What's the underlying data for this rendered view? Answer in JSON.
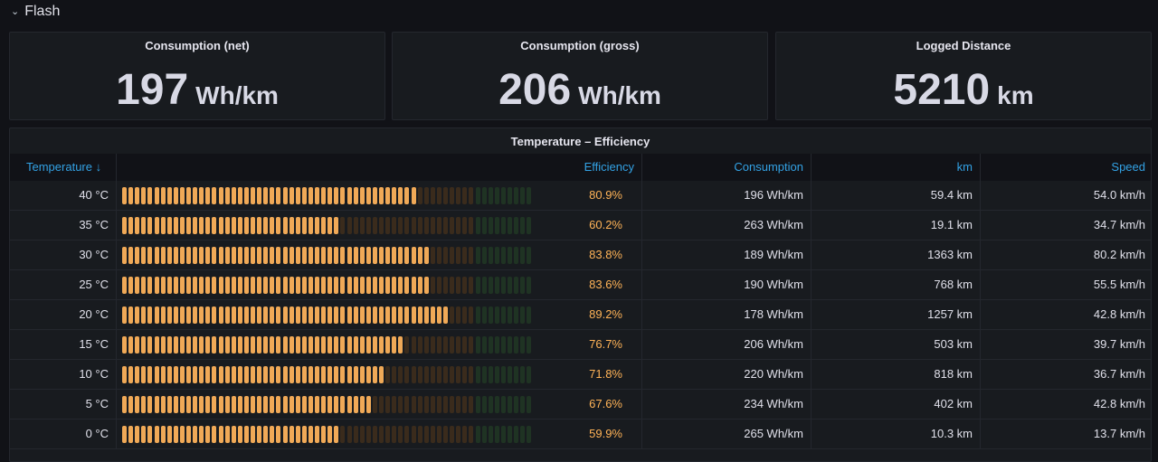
{
  "row": {
    "title": "Flash",
    "chevron_icon": "chevron-down-icon"
  },
  "stats": [
    {
      "title": "Consumption (net)",
      "value": "197",
      "unit": "Wh/km"
    },
    {
      "title": "Consumption (gross)",
      "value": "206",
      "unit": "Wh/km"
    },
    {
      "title": "Logged Distance",
      "value": "5210",
      "unit": "km"
    }
  ],
  "table": {
    "title": "Temperature – Efficiency",
    "headers": {
      "temperature": "Temperature ↓",
      "efficiency": "Efficiency",
      "consumption": "Consumption",
      "km": "km",
      "speed": "Speed"
    },
    "colors": {
      "filled": "#f0a957",
      "empty_orange": "#3a2b1c",
      "empty_green": "#1f3323",
      "value_text": "#ffb357",
      "header_text": "#33a2e5"
    },
    "rows": [
      {
        "temperature": "40 °C",
        "efficiency_pct": 80.9,
        "efficiency": "80.9%",
        "consumption": "196 Wh/km",
        "km": "59.4 km",
        "speed": "54.0 km/h"
      },
      {
        "temperature": "35 °C",
        "efficiency_pct": 60.2,
        "efficiency": "60.2%",
        "consumption": "263 Wh/km",
        "km": "19.1 km",
        "speed": "34.7 km/h"
      },
      {
        "temperature": "30 °C",
        "efficiency_pct": 83.8,
        "efficiency": "83.8%",
        "consumption": "189 Wh/km",
        "km": "1363 km",
        "speed": "80.2 km/h"
      },
      {
        "temperature": "25 °C",
        "efficiency_pct": 83.6,
        "efficiency": "83.6%",
        "consumption": "190 Wh/km",
        "km": "768 km",
        "speed": "55.5 km/h"
      },
      {
        "temperature": "20 °C",
        "efficiency_pct": 89.2,
        "efficiency": "89.2%",
        "consumption": "178 Wh/km",
        "km": "1257 km",
        "speed": "42.8 km/h"
      },
      {
        "temperature": "15 °C",
        "efficiency_pct": 76.7,
        "efficiency": "76.7%",
        "consumption": "206 Wh/km",
        "km": "503 km",
        "speed": "39.7 km/h"
      },
      {
        "temperature": "10 °C",
        "efficiency_pct": 71.8,
        "efficiency": "71.8%",
        "consumption": "220 Wh/km",
        "km": "818 km",
        "speed": "36.7 km/h"
      },
      {
        "temperature": "5 °C",
        "efficiency_pct": 67.6,
        "efficiency": "67.6%",
        "consumption": "234 Wh/km",
        "km": "402 km",
        "speed": "42.8 km/h"
      },
      {
        "temperature": "0 °C",
        "efficiency_pct": 59.9,
        "efficiency": "59.9%",
        "consumption": "265 Wh/km",
        "km": "10.3 km",
        "speed": "13.7 km/h"
      }
    ]
  }
}
